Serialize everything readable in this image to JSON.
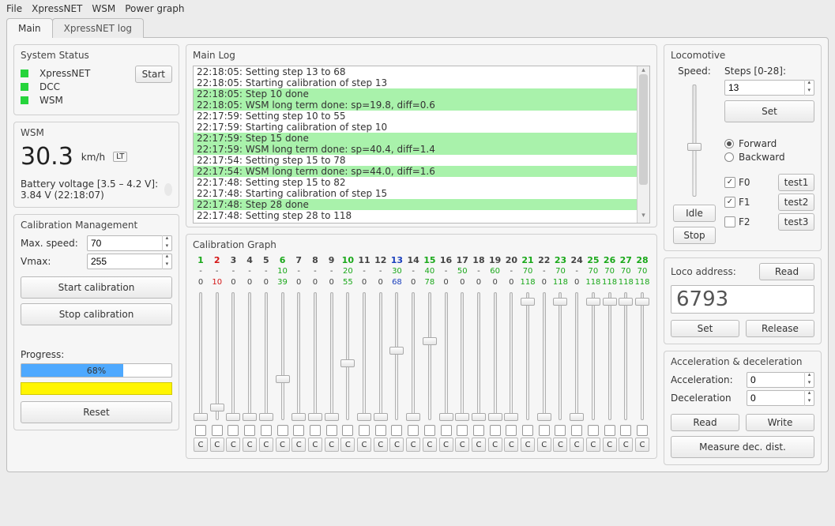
{
  "menubar": [
    "File",
    "XpressNET",
    "WSM",
    "Power graph"
  ],
  "tabs": [
    {
      "label": "Main",
      "active": true
    },
    {
      "label": "XpressNET log",
      "active": false
    }
  ],
  "systemStatus": {
    "title": "System Status",
    "items": [
      "XpressNET",
      "DCC",
      "WSM"
    ],
    "startLabel": "Start"
  },
  "wsm": {
    "title": "WSM",
    "speed": "30.3",
    "unit": "km/h",
    "lt": "LT",
    "battery": "Battery voltage [3.5 – 4.2 V]: 3.84 V (22:18:07)"
  },
  "calibMgmt": {
    "title": "Calibration Management",
    "maxSpeedLabel": "Max. speed:",
    "maxSpeed": "70",
    "vmaxLabel": "Vmax:",
    "vmax": "255",
    "start": "Start calibration",
    "stop": "Stop calibration",
    "progressLabel": "Progress:",
    "progressPct": 68,
    "progressText": "68%",
    "reset": "Reset"
  },
  "mainLog": {
    "title": "Main Log",
    "lines": [
      {
        "t": "22:18:05: Setting step 13 to 68",
        "hl": false
      },
      {
        "t": "22:18:05: Starting calibration of step 13",
        "hl": false
      },
      {
        "t": "22:18:05: Step 10 done",
        "hl": true
      },
      {
        "t": "22:18:05: WSM long term done: sp=19.8, diff=0.6",
        "hl": true
      },
      {
        "t": "22:17:59: Setting step 10 to 55",
        "hl": false
      },
      {
        "t": "22:17:59: Starting calibration of step 10",
        "hl": false
      },
      {
        "t": "22:17:59: Step 15 done",
        "hl": true
      },
      {
        "t": "22:17:59: WSM long term done: sp=40.4, diff=1.4",
        "hl": true
      },
      {
        "t": "22:17:54: Setting step 15 to 78",
        "hl": false
      },
      {
        "t": "22:17:54: WSM long term done: sp=44.0, diff=1.6",
        "hl": true
      },
      {
        "t": "22:17:48: Setting step 15 to 82",
        "hl": false
      },
      {
        "t": "22:17:48: Starting calibration of step 15",
        "hl": false
      },
      {
        "t": "22:17:48: Step 28 done",
        "hl": true
      },
      {
        "t": "22:17:48: Setting step 28 to 118",
        "hl": false
      }
    ]
  },
  "calibGraph": {
    "title": "Calibration Graph",
    "steps": [
      {
        "n": 1,
        "top": "-",
        "bot": "0",
        "val": 0,
        "color": "green"
      },
      {
        "n": 2,
        "top": "-",
        "bot": "10",
        "val": 10,
        "color": "red"
      },
      {
        "n": 3,
        "top": "-",
        "bot": "0",
        "val": 0,
        "color": ""
      },
      {
        "n": 4,
        "top": "-",
        "bot": "0",
        "val": 0,
        "color": ""
      },
      {
        "n": 5,
        "top": "-",
        "bot": "0",
        "val": 0,
        "color": ""
      },
      {
        "n": 6,
        "top": "10",
        "bot": "39",
        "val": 39,
        "color": "green"
      },
      {
        "n": 7,
        "top": "-",
        "bot": "0",
        "val": 0,
        "color": ""
      },
      {
        "n": 8,
        "top": "-",
        "bot": "0",
        "val": 0,
        "color": ""
      },
      {
        "n": 9,
        "top": "-",
        "bot": "0",
        "val": 0,
        "color": ""
      },
      {
        "n": 10,
        "top": "20",
        "bot": "55",
        "val": 55,
        "color": "green"
      },
      {
        "n": 11,
        "top": "-",
        "bot": "0",
        "val": 0,
        "color": ""
      },
      {
        "n": 12,
        "top": "-",
        "bot": "0",
        "val": 0,
        "color": ""
      },
      {
        "n": 13,
        "top": "30",
        "bot": "68",
        "val": 68,
        "color": "blue"
      },
      {
        "n": 14,
        "top": "-",
        "bot": "0",
        "val": 0,
        "color": ""
      },
      {
        "n": 15,
        "top": "40",
        "bot": "78",
        "val": 78,
        "color": "green"
      },
      {
        "n": 16,
        "top": "-",
        "bot": "0",
        "val": 0,
        "color": ""
      },
      {
        "n": 17,
        "top": "50",
        "bot": "0",
        "val": 0,
        "color": ""
      },
      {
        "n": 18,
        "top": "-",
        "bot": "0",
        "val": 0,
        "color": ""
      },
      {
        "n": 19,
        "top": "60",
        "bot": "0",
        "val": 0,
        "color": ""
      },
      {
        "n": 20,
        "top": "-",
        "bot": "0",
        "val": 0,
        "color": ""
      },
      {
        "n": 21,
        "top": "70",
        "bot": "118",
        "val": 118,
        "color": "green"
      },
      {
        "n": 22,
        "top": "-",
        "bot": "0",
        "val": 0,
        "color": ""
      },
      {
        "n": 23,
        "top": "70",
        "bot": "118",
        "val": 118,
        "color": "green"
      },
      {
        "n": 24,
        "top": "-",
        "bot": "0",
        "val": 0,
        "color": ""
      },
      {
        "n": 25,
        "top": "70",
        "bot": "118",
        "val": 118,
        "color": "green"
      },
      {
        "n": 26,
        "top": "70",
        "bot": "118",
        "val": 118,
        "color": "green"
      },
      {
        "n": 27,
        "top": "70",
        "bot": "118",
        "val": 118,
        "color": "green"
      },
      {
        "n": 28,
        "top": "70",
        "bot": "118",
        "val": 118,
        "color": "green"
      }
    ],
    "cLabel": "C"
  },
  "locomotive": {
    "title": "Locomotive",
    "speedLabel": "Speed:",
    "stepsLabel": "Steps [0-28]:",
    "stepsVal": "13",
    "set": "Set",
    "fwd": "Forward",
    "bwd": "Backward",
    "fwdSel": true,
    "idle": "Idle",
    "stop": "Stop",
    "funcs": [
      {
        "name": "F0",
        "checked": true,
        "test": "test1"
      },
      {
        "name": "F1",
        "checked": true,
        "test": "test2"
      },
      {
        "name": "F2",
        "checked": false,
        "test": "test3"
      }
    ]
  },
  "locoAddr": {
    "title": "Loco address:",
    "read": "Read",
    "addr": "6793",
    "set": "Set",
    "release": "Release"
  },
  "accel": {
    "title": "Acceleration & deceleration",
    "accLabel": "Acceleration:",
    "accVal": "0",
    "decLabel": "Deceleration",
    "decVal": "0",
    "read": "Read",
    "write": "Write",
    "measure": "Measure dec. dist."
  }
}
